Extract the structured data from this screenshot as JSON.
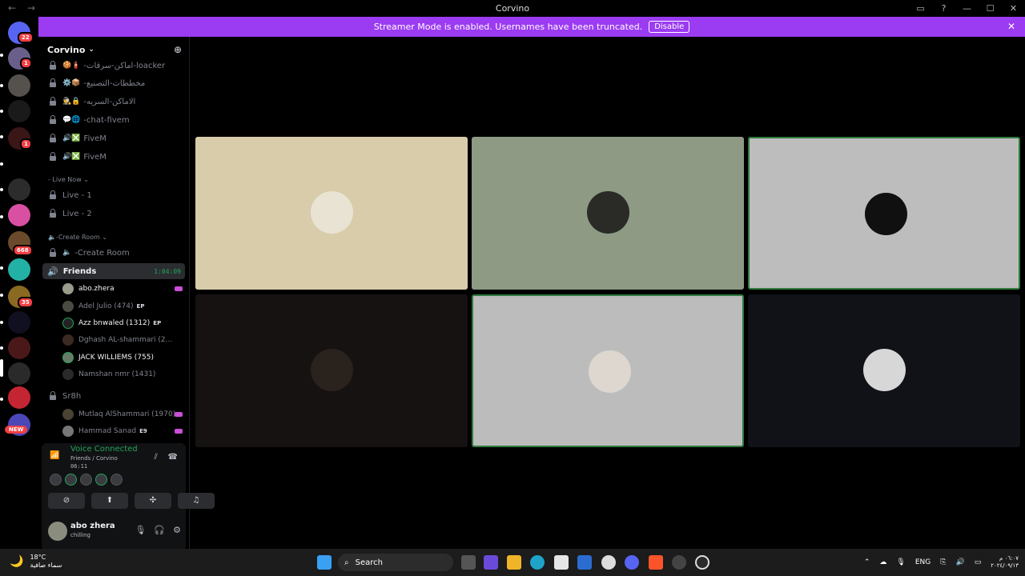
{
  "window": {
    "title": "Corvino",
    "back": "←",
    "forward": "→"
  },
  "banner": {
    "text": "Streamer Mode is enabled. Usernames have been truncated.",
    "button": "Disable"
  },
  "rail": {
    "badges": [
      "22",
      "1",
      "1",
      "668",
      "35"
    ],
    "new_label": "NEW"
  },
  "guild": {
    "name": "Corvino"
  },
  "channels": [
    {
      "name": "-اماكن-سرقات-loacker",
      "emoji": "🍪🧯"
    },
    {
      "name": "-مخططات-التصنيع",
      "emoji": "⚙️📦"
    },
    {
      "name": "-الاماكن-السريه",
      "emoji": "🕵️🔒"
    },
    {
      "name": "-chat-fivem",
      "emoji": "💬🌐"
    },
    {
      "name": "FiveM",
      "emoji": "🔊❎"
    },
    {
      "name": "FiveM",
      "emoji": "🔊❎"
    }
  ],
  "categories": {
    "live_now": "- Live Now",
    "create_room": "-Create Room"
  },
  "live_channels": [
    {
      "name": "Live - 1"
    },
    {
      "name": "Live - 2"
    }
  ],
  "create_room_channel": "-Create Room",
  "active_channel": {
    "name": "Friends",
    "timer": "1:04:09"
  },
  "voice_users": [
    {
      "name": "abo.zhera",
      "tag": "",
      "live": true
    },
    {
      "name": "Adel Julio (474)",
      "tag": "EP",
      "live": false
    },
    {
      "name": "Azz bnwaled (1312)",
      "tag": "EP",
      "live": false
    },
    {
      "name": "Dghash AL-shammari (2...",
      "tag": "",
      "live": false
    },
    {
      "name": "JACK WILLIEMS (755)",
      "tag": "",
      "live": false
    },
    {
      "name": "Namshan nmr (1431)",
      "tag": "",
      "live": false
    }
  ],
  "sr8h": {
    "name": "Sr8h"
  },
  "sr8h_users": [
    {
      "name": "Mutlaq AlShammari (1970)",
      "tag": "",
      "live": true
    },
    {
      "name": "Hammad Sanad",
      "tag": "E9",
      "live": true
    }
  ],
  "voice_panel": {
    "status": "Voice Connected",
    "sub": "Friends  / Corvino",
    "time": "06:11"
  },
  "user_panel": {
    "name": "abo zhera",
    "status": "chilling"
  },
  "tiles": [
    {
      "bg": "#d8ccab",
      "avatar": "#e9e3d3",
      "speaking": false
    },
    {
      "bg": "#8e9a84",
      "avatar": "#2a2a26",
      "speaking": false
    },
    {
      "bg": "#bdbdbd",
      "avatar": "#101010",
      "speaking": true
    },
    {
      "bg": "#161212",
      "avatar": "#2a221c",
      "speaking": false
    },
    {
      "bg": "#bcbcbc",
      "avatar": "#ddd7cf",
      "speaking": true
    },
    {
      "bg": "#101217",
      "avatar": "#d7d7d7",
      "speaking": false
    }
  ],
  "taskbar": {
    "temp": "18°C",
    "weather": "سماء صافية",
    "search": "Search",
    "lang": "ENG",
    "time": "٠٦:٠٧ م",
    "date": "٢٠٢٤/٠٩/١٣"
  },
  "colors": {
    "accent": "#9b3bf2",
    "green": "#23a55a",
    "red": "#f23f43"
  }
}
